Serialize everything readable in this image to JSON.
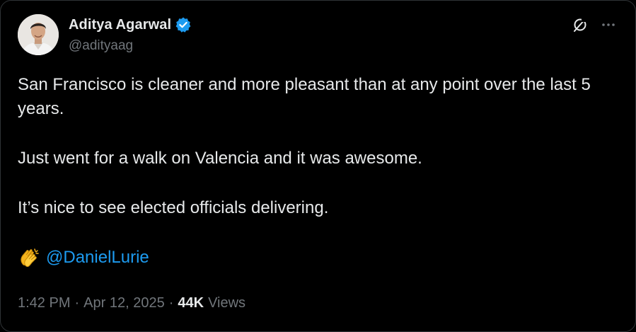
{
  "author": {
    "display_name": "Aditya Agarwal",
    "handle": "@adityaag",
    "verified_color": "#1d9bf0"
  },
  "icons": {
    "verified": "verified-badge-icon",
    "grok": "grok-icon",
    "more": "more-options-icon",
    "clap": "clapping-hands-emoji-icon"
  },
  "tweet": {
    "paragraphs": [
      "San Francisco is cleaner and more pleasant than at any point over the last 5 years.",
      "Just went for a walk on Valencia and it was awesome.",
      "It’s nice to see elected officials delivering."
    ],
    "mention": "@DanielLurie"
  },
  "meta": {
    "time": "1:42 PM",
    "separator": "·",
    "date": "Apr 12, 2025",
    "views_count": "44K",
    "views_label": "Views"
  },
  "colors": {
    "background": "#000000",
    "text": "#e7e9ea",
    "muted": "#71767b",
    "link": "#1d9bf0"
  }
}
